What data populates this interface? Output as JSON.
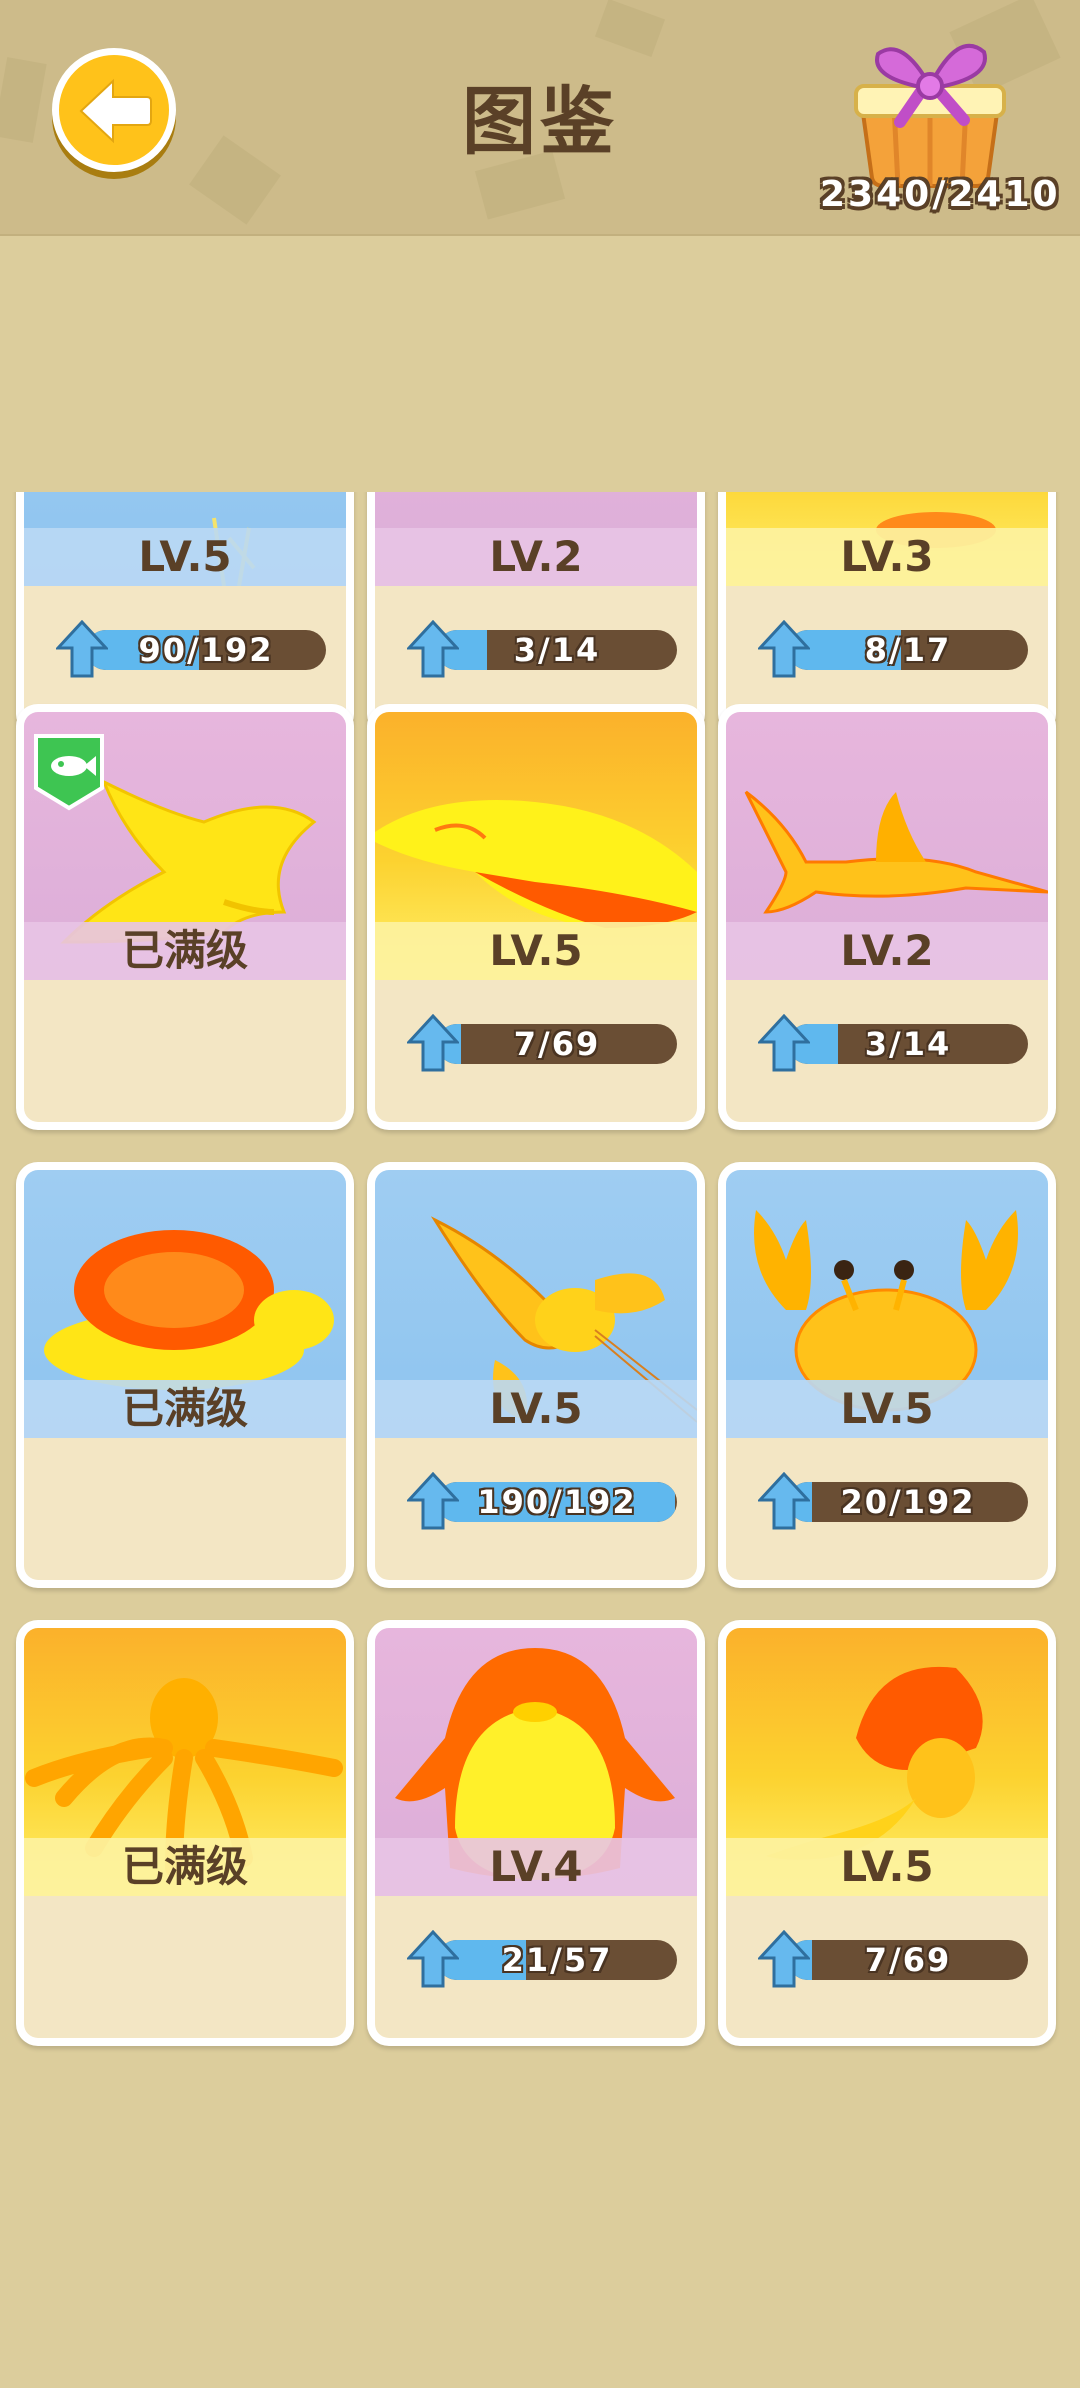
{
  "header": {
    "title": "图鉴",
    "gift_count": "2340/2410"
  },
  "colors": {
    "accent": "#ffc21a",
    "progress_fill": "#5fb8ee",
    "progress_track": "#6a4e34",
    "text_brown": "#5a4027"
  },
  "cards": [
    {
      "name": "card-1",
      "bg": "blue",
      "level": "LV.5",
      "progress": "90/192",
      "fill": 0.47,
      "icon": "sun-creature-icon"
    },
    {
      "name": "card-2",
      "bg": "pink",
      "level": "LV.2",
      "progress": "3/14",
      "fill": 0.21,
      "icon": "creature-icon"
    },
    {
      "name": "card-3",
      "bg": "yellow",
      "level": "LV.3",
      "progress": "8/17",
      "fill": 0.47,
      "icon": "creature-icon"
    },
    {
      "name": "card-manta",
      "bg": "pink",
      "level": "已满级",
      "progress": null,
      "fill": null,
      "icon": "manta-ray-icon",
      "badge": "fish-badge-icon"
    },
    {
      "name": "card-whale",
      "bg": "yellow",
      "level": "LV.5",
      "progress": "7/69",
      "fill": 0.1,
      "icon": "whale-icon"
    },
    {
      "name": "card-swordfish",
      "bg": "pink",
      "level": "LV.2",
      "progress": "3/14",
      "fill": 0.21,
      "icon": "swordfish-icon"
    },
    {
      "name": "card-turtle",
      "bg": "blue",
      "level": "已满级",
      "progress": null,
      "fill": null,
      "icon": "turtle-icon"
    },
    {
      "name": "card-lobster",
      "bg": "blue",
      "level": "LV.5",
      "progress": "190/192",
      "fill": 0.99,
      "icon": "lobster-icon"
    },
    {
      "name": "card-crab",
      "bg": "blue",
      "level": "LV.5",
      "progress": "20/192",
      "fill": 0.1,
      "icon": "crab-icon"
    },
    {
      "name": "card-octopus",
      "bg": "yellow",
      "level": "已满级",
      "progress": null,
      "fill": null,
      "icon": "octopus-icon"
    },
    {
      "name": "card-penguin",
      "bg": "pink",
      "level": "LV.4",
      "progress": "21/57",
      "fill": 0.37,
      "icon": "penguin-icon"
    },
    {
      "name": "card-mermaid",
      "bg": "yellow",
      "level": "LV.5",
      "progress": "7/69",
      "fill": 0.1,
      "icon": "mermaid-icon"
    }
  ]
}
